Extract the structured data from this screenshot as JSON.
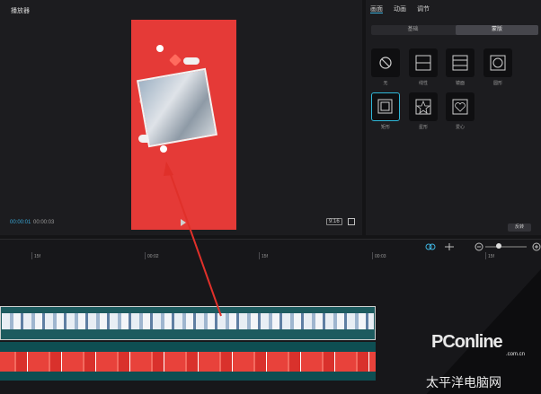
{
  "player": {
    "title": "播放器",
    "time_current": "00:00:01",
    "time_total": "00:00:03",
    "ratio_label": "9:16"
  },
  "right_panel": {
    "tabs": [
      "画面",
      "动画",
      "调节"
    ],
    "subtabs": [
      "基础",
      "蒙版"
    ],
    "masks": [
      "无",
      "线性",
      "镜面",
      "圆形",
      "矩形",
      "星形",
      "爱心"
    ],
    "reverse_label": "反转"
  },
  "timeline": {
    "ruler_labels": [
      "15f",
      "00:02",
      "15f",
      "00:03",
      "15f"
    ]
  },
  "watermark": {
    "brand": "PConline",
    "domain": ".com.cn",
    "tagline": "太平洋电脑网"
  },
  "colors": {
    "accent": "#3fb4e0",
    "arrow": "#e0302a",
    "canvas_bg": "#e53a37"
  },
  "icons": [
    "play-icon",
    "fullscreen-icon",
    "link-icon",
    "zoom-out-icon",
    "zoom-in-icon",
    "mask-none-icon",
    "mask-star-icon",
    "mask-heart-icon"
  ]
}
